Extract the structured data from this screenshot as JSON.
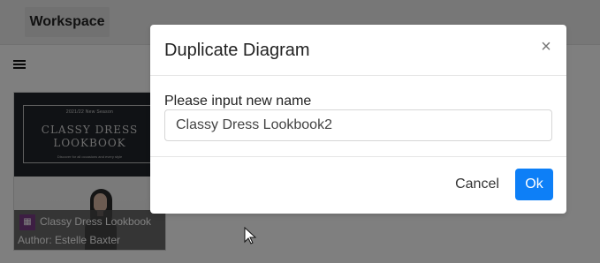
{
  "header": {
    "workspace_label": "Workspace"
  },
  "card": {
    "thumbnail_small_top": "2021/22 New Season",
    "thumbnail_title_line1": "CLASSY DRESS",
    "thumbnail_title_line2": "LOOKBOOK",
    "thumbnail_small_bottom": "Discover for all occasions and every style",
    "title": "Classy Dress Lookbook",
    "author": "Author: Estelle Baxter"
  },
  "dialog": {
    "title": "Duplicate Diagram",
    "close_icon": "×",
    "field_label": "Please input new name",
    "input_value": "Classy Dress Lookbook2",
    "cancel_label": "Cancel",
    "ok_label": "Ok"
  },
  "colors": {
    "primary_button": "#0d7ff7",
    "overlay": "#000000",
    "card_icon": "#7b3d86"
  },
  "icons": {
    "menu": "hamburger-icon",
    "close": "close-icon",
    "diagram": "diagram-icon",
    "cursor": "mouse-cursor-icon"
  }
}
